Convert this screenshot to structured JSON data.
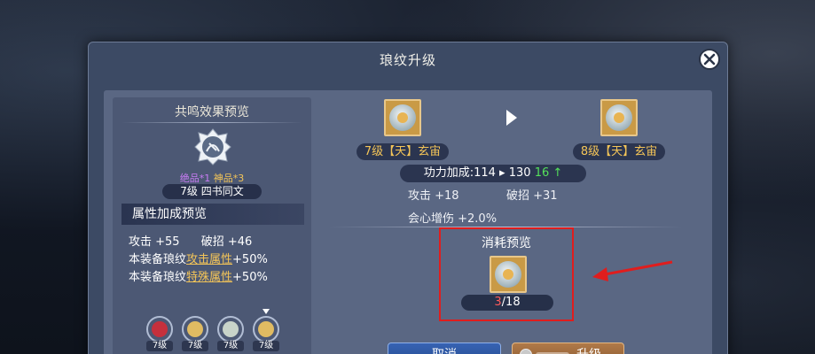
{
  "dialog": {
    "title": "琅纹升级"
  },
  "resonance": {
    "title": "共鸣效果预览",
    "counts": {
      "jue_label": "绝品*1",
      "shen_label": "神品*3"
    },
    "level_label": "7级 四书同文",
    "attr_preview_title": "属性加成预览",
    "lines": [
      {
        "a": "攻击 +55",
        "b": "破招 +46"
      },
      {
        "prefix": "本装备琅纹",
        "highlight": "攻击属性",
        "suffix": "+50%"
      },
      {
        "prefix": "本装备琅纹",
        "highlight": "特殊属性",
        "suffix": "+50%"
      }
    ],
    "gems": [
      {
        "label": "7级",
        "color": "#c5303d"
      },
      {
        "label": "7级",
        "color": "#e0bb62"
      },
      {
        "label": "7级",
        "color": "#c8d3c9"
      },
      {
        "label": "7级",
        "color": "#e0bb62"
      }
    ]
  },
  "upgrade": {
    "current_item": "7级【天】玄宙",
    "next_item": "8级【天】玄宙",
    "power": {
      "label": "功力加成:114",
      "arrow": "▸",
      "to": "130",
      "gain": "16",
      "gain_arrow": "↑"
    },
    "stats": {
      "attack": "攻击 +18",
      "break": "破招 +31",
      "crit": "会心增伤 +2.0%"
    }
  },
  "consume": {
    "title": "消耗预览",
    "have": "3",
    "sep_need": "/18"
  },
  "buttons": {
    "cancel": "取消",
    "upgrade": "升级"
  },
  "colors": {
    "highlight_box": "#e01d1d",
    "annotation_arrow": "#e01d1d",
    "gold": "#f4c558",
    "green": "#55e05a",
    "shortage_red": "#ff5a5a"
  }
}
